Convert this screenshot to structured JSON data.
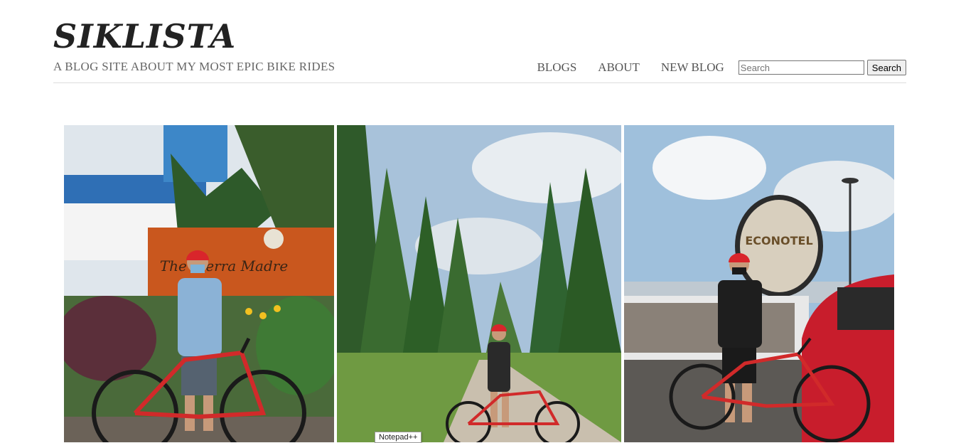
{
  "header": {
    "title": "SIKLISTA",
    "tagline": "A BLOG SITE ABOUT MY MOST EPIC BIKE RIDES"
  },
  "nav": {
    "items": [
      "BLOGS",
      "ABOUT",
      "NEW BLOG"
    ],
    "search_placeholder": "Search",
    "search_button": "Search"
  },
  "gallery": {
    "photos": [
      {
        "sign_text": "The Sierra Madre"
      },
      {
        "sign_text": ""
      },
      {
        "sign_text": "ECONOTEL"
      }
    ]
  },
  "tooltip": {
    "text": "Notepad++"
  }
}
